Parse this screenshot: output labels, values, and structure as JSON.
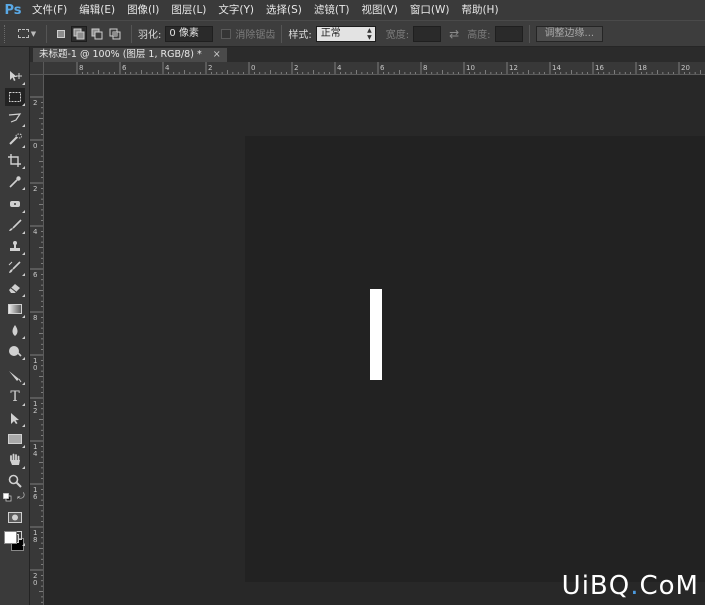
{
  "app": {
    "logo": "Ps",
    "menu": [
      "文件(F)",
      "编辑(E)",
      "图像(I)",
      "图层(L)",
      "文字(Y)",
      "选择(S)",
      "滤镜(T)",
      "视图(V)",
      "窗口(W)",
      "帮助(H)"
    ]
  },
  "options_bar": {
    "feather_label": "羽化:",
    "feather_value": "0 像素",
    "antialias_label": "消除锯齿",
    "style_label": "样式:",
    "style_value": "正常",
    "width_label": "宽度:",
    "height_label": "高度:",
    "refine_edge": "调整边缘..."
  },
  "document": {
    "tab_title": "未标题-1 @ 100% (图层 1, RGB/8) *",
    "tab_close": "×"
  },
  "rulers": {
    "top": [
      "8",
      "6",
      "4",
      "2",
      "0",
      "2",
      "4",
      "6",
      "8",
      "10",
      "12",
      "14",
      "16",
      "18",
      "20"
    ],
    "left": [
      "2",
      "0",
      "2",
      "4",
      "6",
      "8",
      "10",
      "12",
      "14",
      "16",
      "18",
      "20"
    ]
  },
  "tools": [
    "move-icon",
    "rectangular-marquee-icon",
    "lasso-icon",
    "quick-selection-icon",
    "crop-icon",
    "eyedropper-icon",
    "spot-healing-icon",
    "brush-icon",
    "clone-stamp-icon",
    "history-brush-icon",
    "eraser-icon",
    "gradient-icon",
    "blur-icon",
    "dodge-icon",
    "pen-icon",
    "type-icon",
    "path-selection-icon",
    "rectangle-shape-icon",
    "hand-icon",
    "zoom-icon",
    "quick-mask-icon",
    "screen-mode-icon"
  ],
  "colors": {
    "foreground": "#ffffff",
    "background": "#000000",
    "canvas": "#222222",
    "pasteboard": "#282828",
    "logo_blue": "#5aa9e6"
  },
  "watermark": {
    "a": "UiBQ",
    "dot": ".",
    "b": "CoM"
  }
}
